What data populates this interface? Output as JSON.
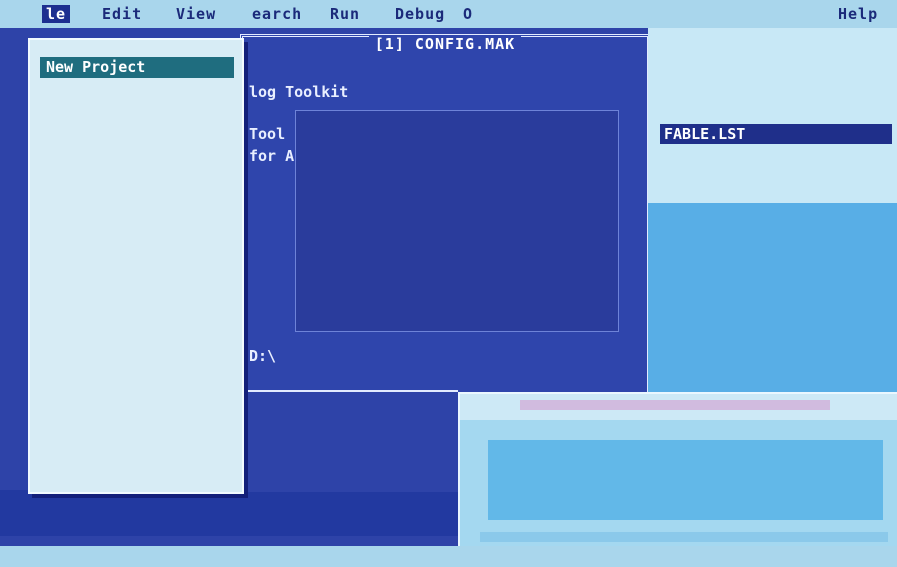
{
  "menubar": {
    "items": [
      {
        "label": "le"
      },
      {
        "label": "Edit"
      },
      {
        "label": "View"
      },
      {
        "label": "earch"
      },
      {
        "label": "Run"
      },
      {
        "label": "Debug"
      },
      {
        "label": "O"
      }
    ],
    "help_label": "Help"
  },
  "file_menu": {
    "selected_label": "New Project"
  },
  "editor": {
    "title": "[1] CONFIG.MAK",
    "lines": [
      "log Toolkit",
      "Tool",
      "for A",
      "D:\\"
    ]
  },
  "right_window": {
    "highlight": "FABLE.LST"
  },
  "colors": {
    "menubar": "#a9d6ec",
    "desktop": "#2e43a8",
    "highlight": "#1f6d7f"
  }
}
